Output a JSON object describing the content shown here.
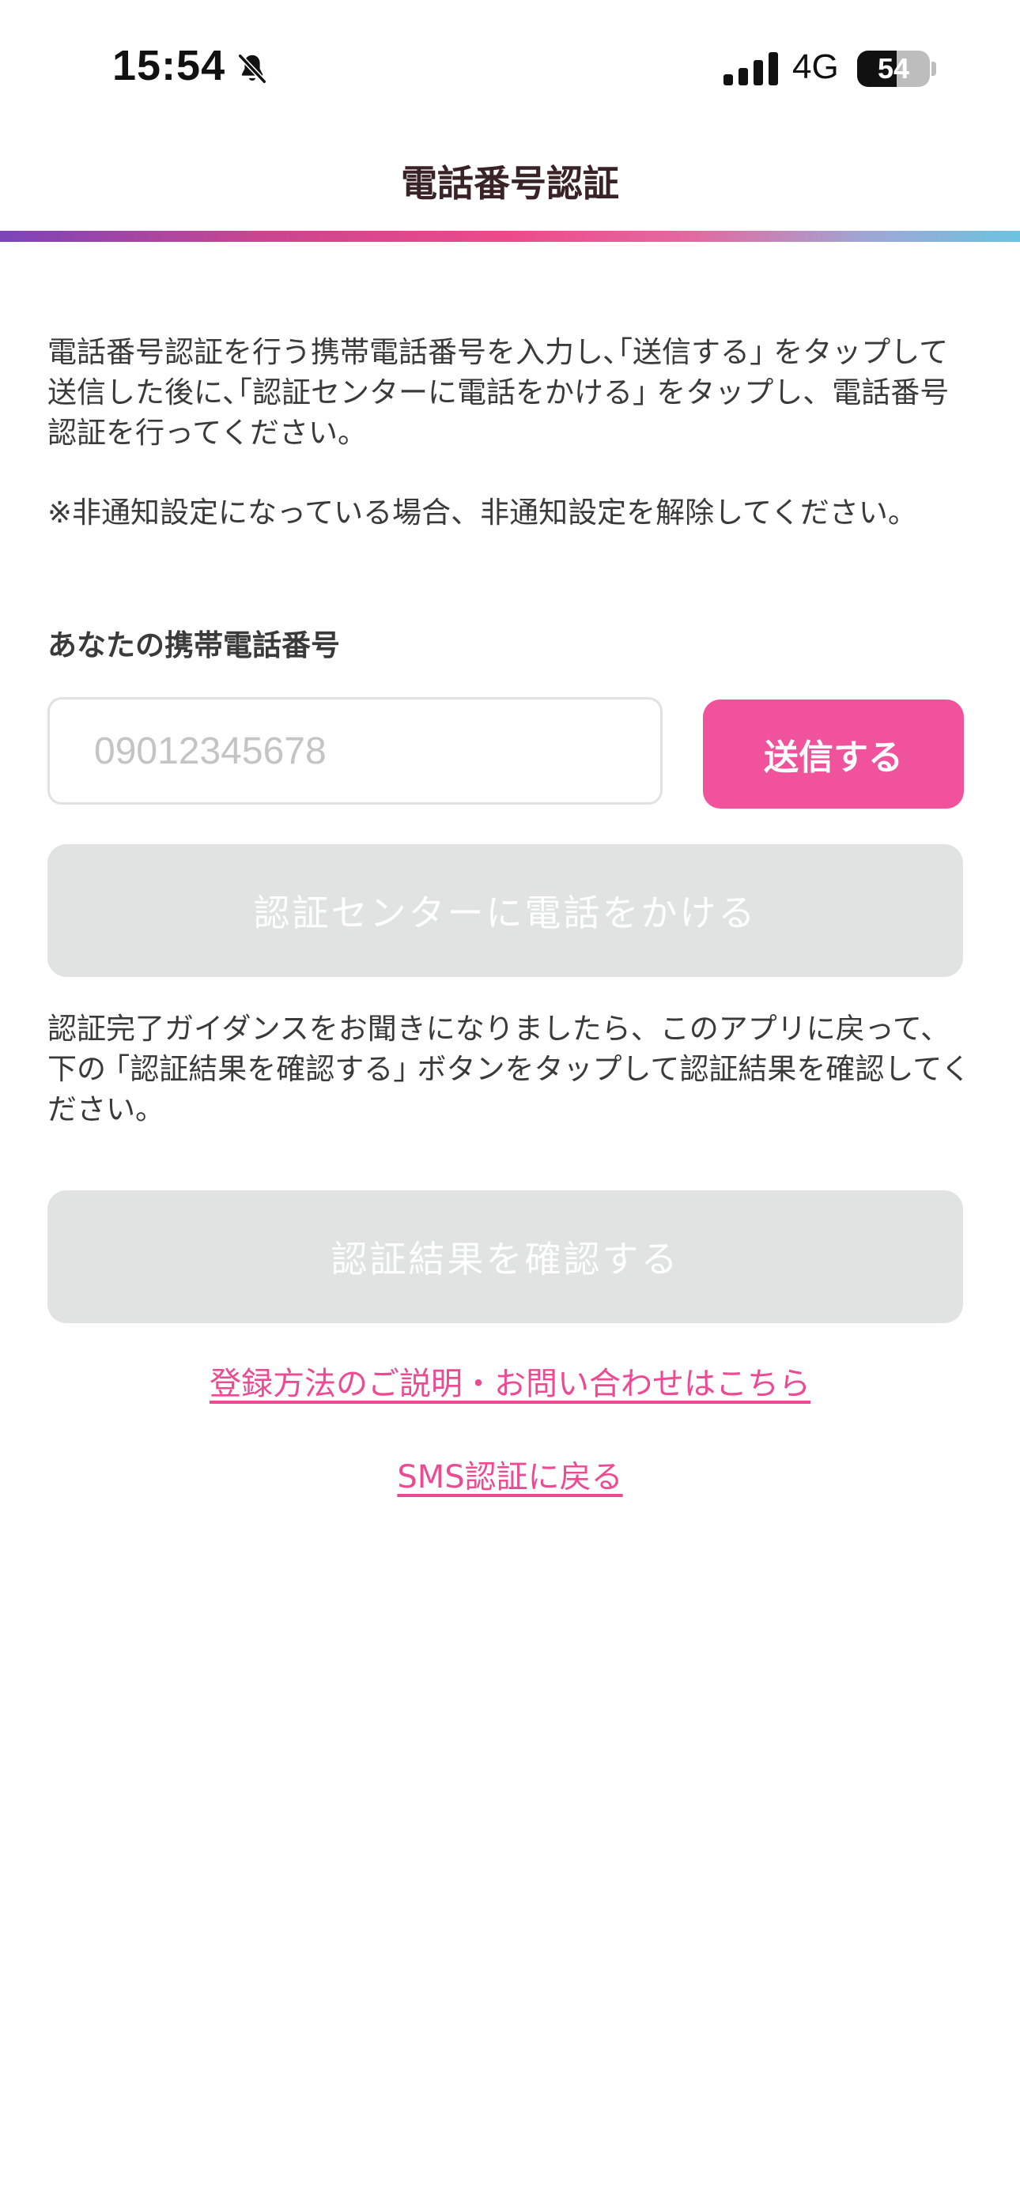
{
  "status_bar": {
    "time": "15:54",
    "network": "4G",
    "battery_level": "54",
    "battery_fraction": 0.54,
    "icons": [
      "bell-slash-icon",
      "signal-icon",
      "battery-icon"
    ]
  },
  "header": {
    "title": "電話番号認証"
  },
  "instructions": {
    "text": "電話番号認証を行う携帯電話番号を入力し､｢送信する｣ をタップして送信した後に､｢認証センターに電話をかける｣ をタップし、電話番号認証を行ってください。",
    "note": "※非通知設定になっている場合、非通知設定を解除してください。"
  },
  "phone": {
    "label": "あなたの携帯電話番号",
    "value": "",
    "placeholder": "09012345678",
    "send_label": "送信する"
  },
  "call_button": {
    "label": "認証センターに電話をかける"
  },
  "guidance": {
    "text": "認証完了ガイダンスをお聞きになりましたら、このアプリに戻って、下の ｢認証結果を確認する｣ ボタンをタップして認証結果を確認してください。"
  },
  "result_button": {
    "label": "認証結果を確認する"
  },
  "links": {
    "help": "登録方法のご説明・お問い合わせはこちら",
    "sms_back": "SMS認証に戻る"
  },
  "colors": {
    "accent": "#f0529b",
    "disabled": "#e1e2e2",
    "link": "#ec4a92",
    "title": "#3a2326"
  }
}
